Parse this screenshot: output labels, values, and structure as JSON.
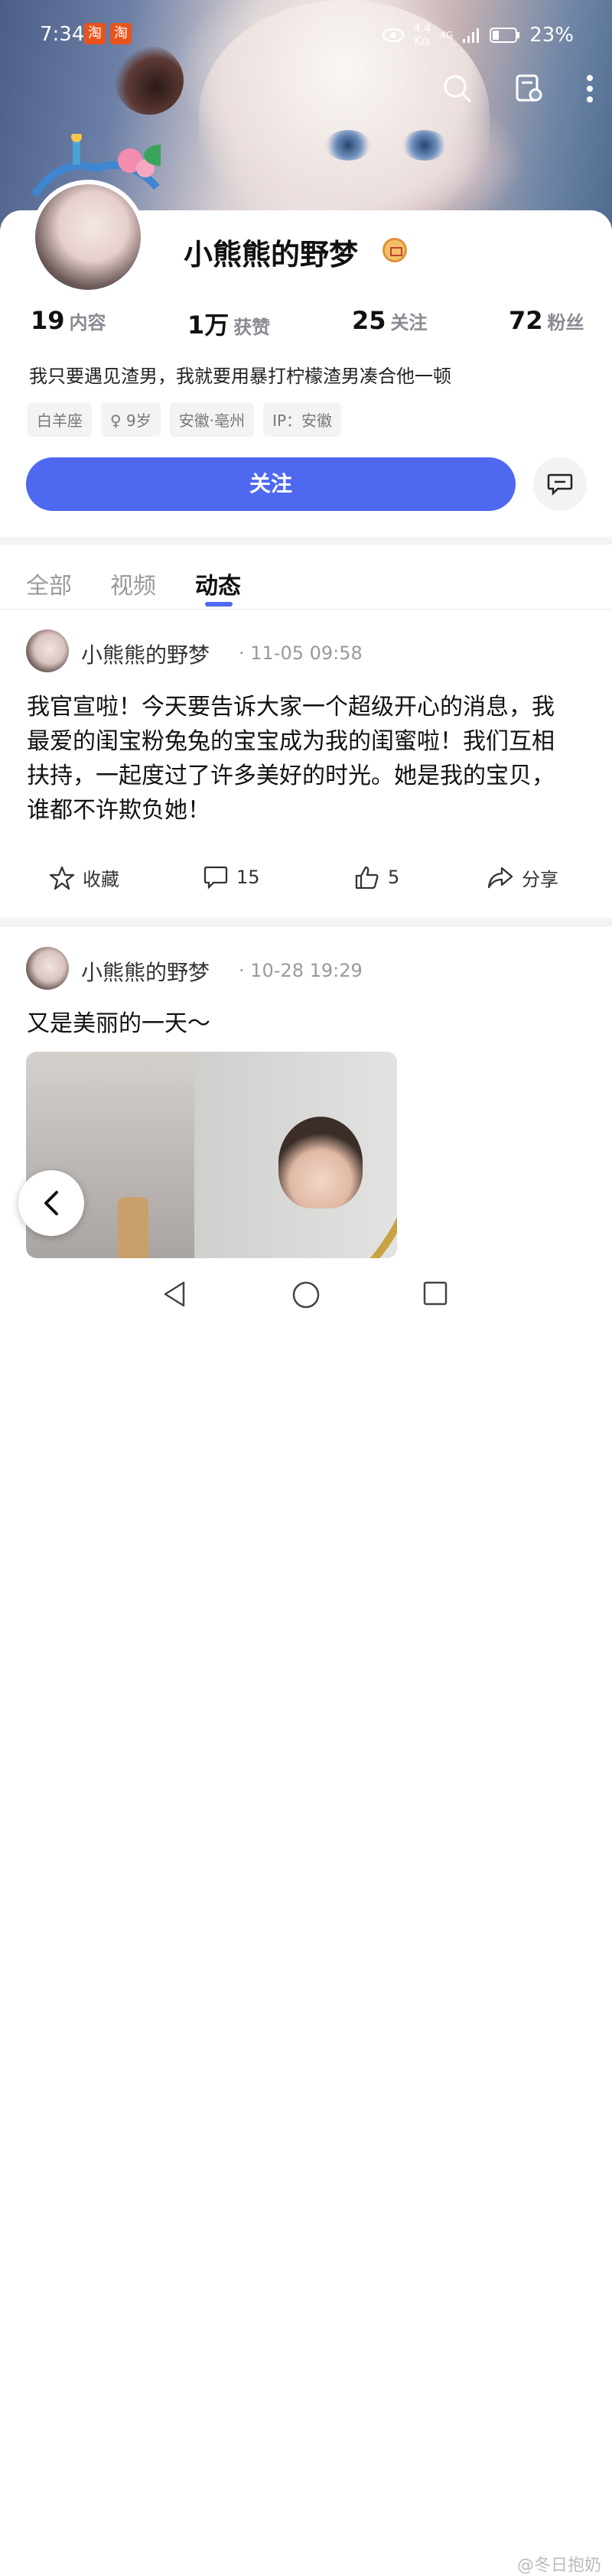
{
  "status_bar": {
    "time": "7:34",
    "app_badges": [
      "淘",
      "淘"
    ],
    "net_speed_value": "4.4",
    "net_speed_unit": "K/s",
    "signal": "4G",
    "battery": "23%"
  },
  "profile": {
    "name": "小熊熊的野梦",
    "stats": [
      {
        "value": "19",
        "label": "内容"
      },
      {
        "value": "1万",
        "label": "获赞"
      },
      {
        "value": "25",
        "label": "关注"
      },
      {
        "value": "72",
        "label": "粉丝"
      }
    ],
    "bio": "我只要遇见渣男，我就要用暴打柠檬渣男凑合他一顿",
    "tags": [
      "白羊座",
      "♀ 9岁",
      "安徽·亳州",
      "IP：安徽"
    ],
    "follow_label": "关注"
  },
  "tabs": [
    {
      "label": "全部",
      "active": false
    },
    {
      "label": "视频",
      "active": false
    },
    {
      "label": "动态",
      "active": true
    }
  ],
  "posts": [
    {
      "author": "小熊熊的野梦",
      "time": "11-05 09:58",
      "text": "我官宣啦！今天要告诉大家一个超级开心的消息，我最爱的闺宝粉兔兔的宝宝成为我的闺蜜啦！我们互相扶持，一起度过了许多美好的时光。她是我的宝贝，谁都不许欺负她！",
      "actions": {
        "favorite": "收藏",
        "comments": "15",
        "likes": "5",
        "share": "分享"
      }
    },
    {
      "author": "小熊熊的野梦",
      "time": "10-28 19:29",
      "text": "又是美丽的一天～"
    }
  ],
  "watermark": "@冬日抱奶",
  "colors": {
    "accent": "#4e68f0",
    "gray_bg": "#f2f3f5"
  }
}
